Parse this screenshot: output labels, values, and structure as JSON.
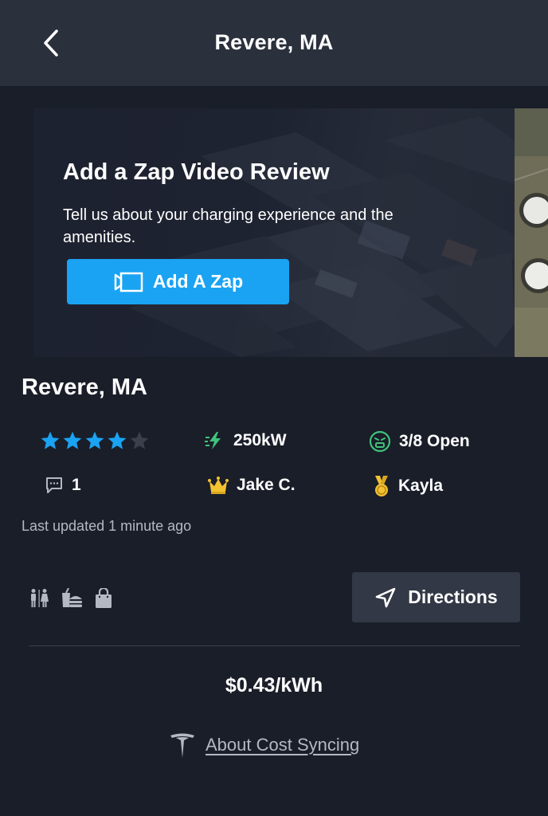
{
  "header": {
    "title": "Revere, MA"
  },
  "promo": {
    "title": "Add a Zap Video Review",
    "description": "Tell us about your charging experience and the amenities.",
    "button_label": "Add A Zap"
  },
  "station": {
    "name": "Revere, MA",
    "rating": 4,
    "rating_max": 5,
    "power": "250kW",
    "availability": "3/8 Open",
    "comments": "1",
    "king": "Jake C.",
    "medal_holder": "Kayla",
    "last_updated": "Last updated 1 minute ago"
  },
  "amenities": [
    "restroom-icon",
    "food-icon",
    "shopping-icon"
  ],
  "actions": {
    "directions_label": "Directions"
  },
  "pricing": {
    "price": "$0.43/kWh",
    "cost_sync_label": "About Cost Syncing"
  },
  "colors": {
    "background": "#1a1e29",
    "header": "#2b303d",
    "accent_blue": "#1aa3f2",
    "power_green": "#3ec47a",
    "star": "#1aa3f2",
    "star_empty": "#3a3f4b",
    "gold": "#f2c230"
  }
}
